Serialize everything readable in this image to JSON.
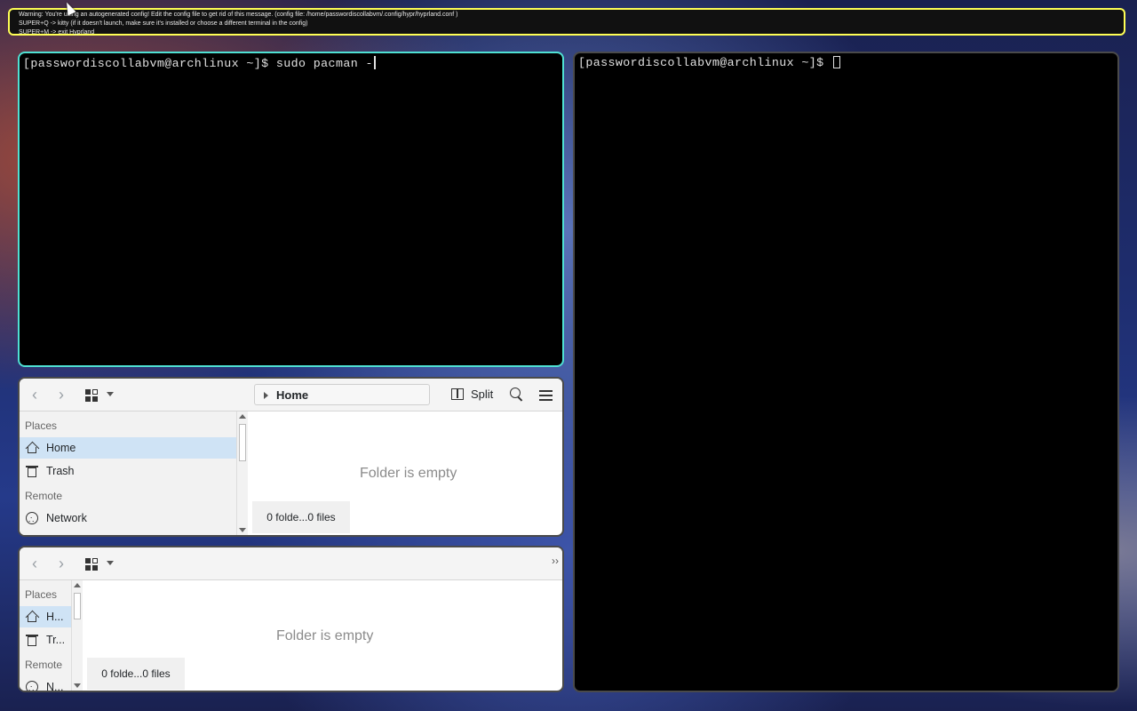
{
  "warning": {
    "line1": "Warning: You're using an autogenerated config! Edit the config file to get rid of this message. (config file: /home/passwordiscollabvm/.config/hypr/hyprland.conf )",
    "line2": "SUPER+Q -> kitty (if it doesn't launch, make sure it's installed or choose a different terminal in the config)",
    "line3": "SUPER+M -> exit Hyprland"
  },
  "terminal_left": {
    "prompt": "[passwordiscollabvm@archlinux ~]$ ",
    "command": "sudo pacman -"
  },
  "terminal_right": {
    "prompt": "[passwordiscollabvm@archlinux ~]$ "
  },
  "file_manager_1": {
    "breadcrumb": "Home",
    "split_label": "Split",
    "places_header": "Places",
    "places": [
      "Home",
      "Trash"
    ],
    "remote_header": "Remote",
    "remote": [
      "Network"
    ],
    "empty_message": "Folder is empty",
    "status": "0 folde...0 files"
  },
  "file_manager_2": {
    "places_header": "Places",
    "places": [
      "H...",
      "Tr..."
    ],
    "remote_header": "Remote",
    "remote": [
      "N..."
    ],
    "empty_message": "Folder is empty",
    "status": "0 folde...0 files"
  },
  "colors": {
    "active_border": "#4fe0d3",
    "inactive_border": "#4a4a4a",
    "warning_border": "#ffff55",
    "selection": "#cfe3f5"
  }
}
